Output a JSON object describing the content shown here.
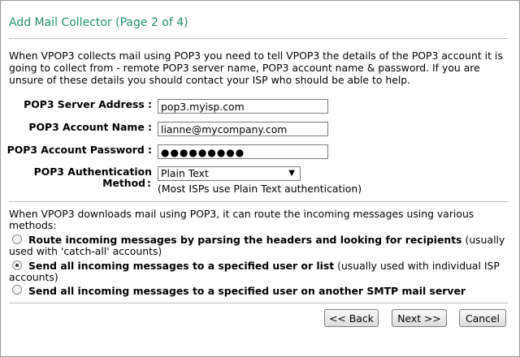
{
  "title": "Add Mail Collector (Page 2 of 4)",
  "intro": "When VPOP3 collects mail using POP3 you need to tell VPOP3 the details of the POP3 account it is going to collect from - remote POP3 server name, POP3 account name & password. If you are unsure of these details you should contact your ISP who should be able to help.",
  "form": {
    "server_label": "POP3 Server Address :",
    "server_value": "pop3.myisp.com",
    "account_label": "POP3 Account Name :",
    "account_value": "lianne@mycompany.com",
    "password_label": "POP3 Account Password :",
    "password_mask": "●●●●●●●●●",
    "auth_label_line1": "POP3 Authentication",
    "auth_label_line2": "Method",
    "colon": ":",
    "auth_value": "Plain Text",
    "auth_note": "(Most ISPs use Plain Text authentication)"
  },
  "routing": {
    "description": "When VPOP3 downloads mail using POP3, it can route the incoming messages using various methods:",
    "options": [
      {
        "bold": "Route incoming messages by parsing the headers and looking for recipients",
        "rest": " (usually used with 'catch-all' accounts)",
        "selected": false
      },
      {
        "bold": "Send all incoming messages to a specified user or list",
        "rest": " (usually used with individual ISP accounts)",
        "selected": true
      },
      {
        "bold": "Send all incoming messages to a specified user on another SMTP mail server",
        "rest": "",
        "selected": false
      }
    ]
  },
  "buttons": {
    "back": "<< Back",
    "next": "Next >>",
    "cancel": "Cancel"
  }
}
